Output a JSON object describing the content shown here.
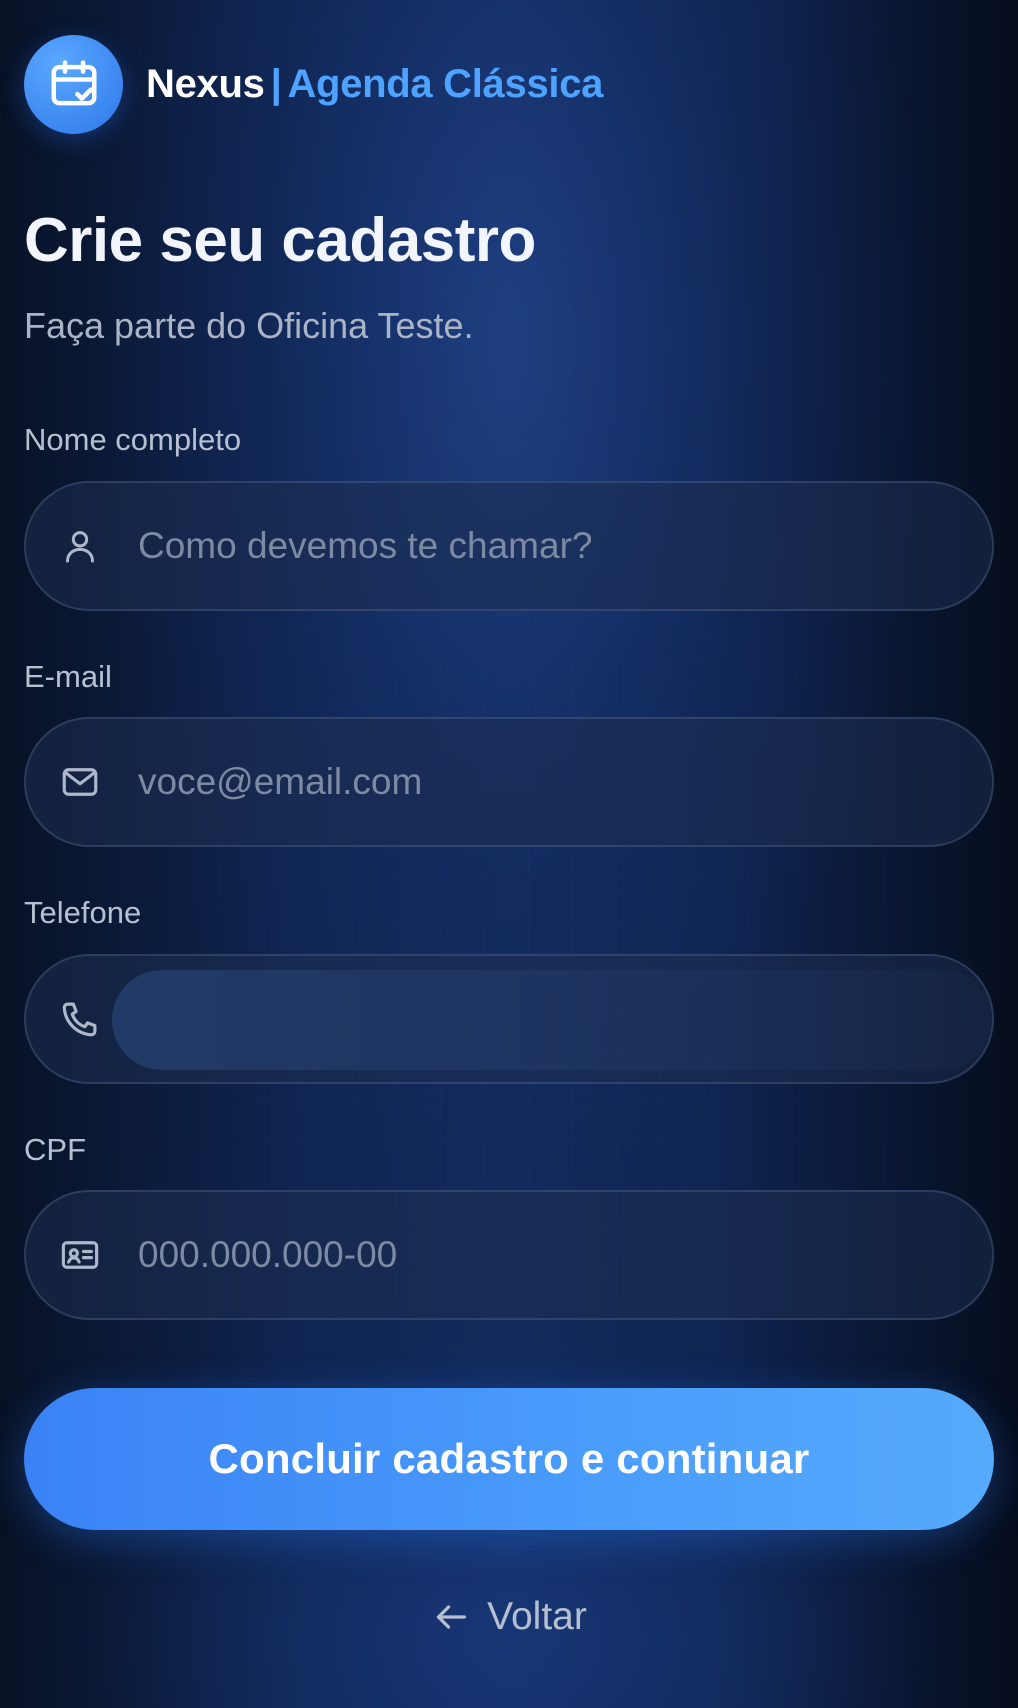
{
  "header": {
    "brand_name": "Nexus",
    "separator": "|",
    "product_name": "Agenda Clássica",
    "logo_icon": "calendar-check-icon",
    "accent_color": "#4da3ff"
  },
  "page": {
    "title": "Crie seu cadastro",
    "subtitle": "Faça parte do Oficina Teste."
  },
  "form": {
    "name": {
      "label": "Nome completo",
      "placeholder": "Como devemos te chamar?",
      "icon": "user-icon"
    },
    "email": {
      "label": "E-mail",
      "placeholder": "voce@email.com",
      "icon": "mail-icon"
    },
    "phone": {
      "label": "Telefone",
      "placeholder": "",
      "icon": "phone-icon"
    },
    "cpf": {
      "label": "CPF",
      "placeholder": "000.000.000-00",
      "icon": "id-card-icon"
    }
  },
  "actions": {
    "submit_label": "Concluir cadastro e continuar",
    "submit_color": "#4a9dfb",
    "back_label": "Voltar",
    "back_icon": "arrow-left-icon"
  }
}
